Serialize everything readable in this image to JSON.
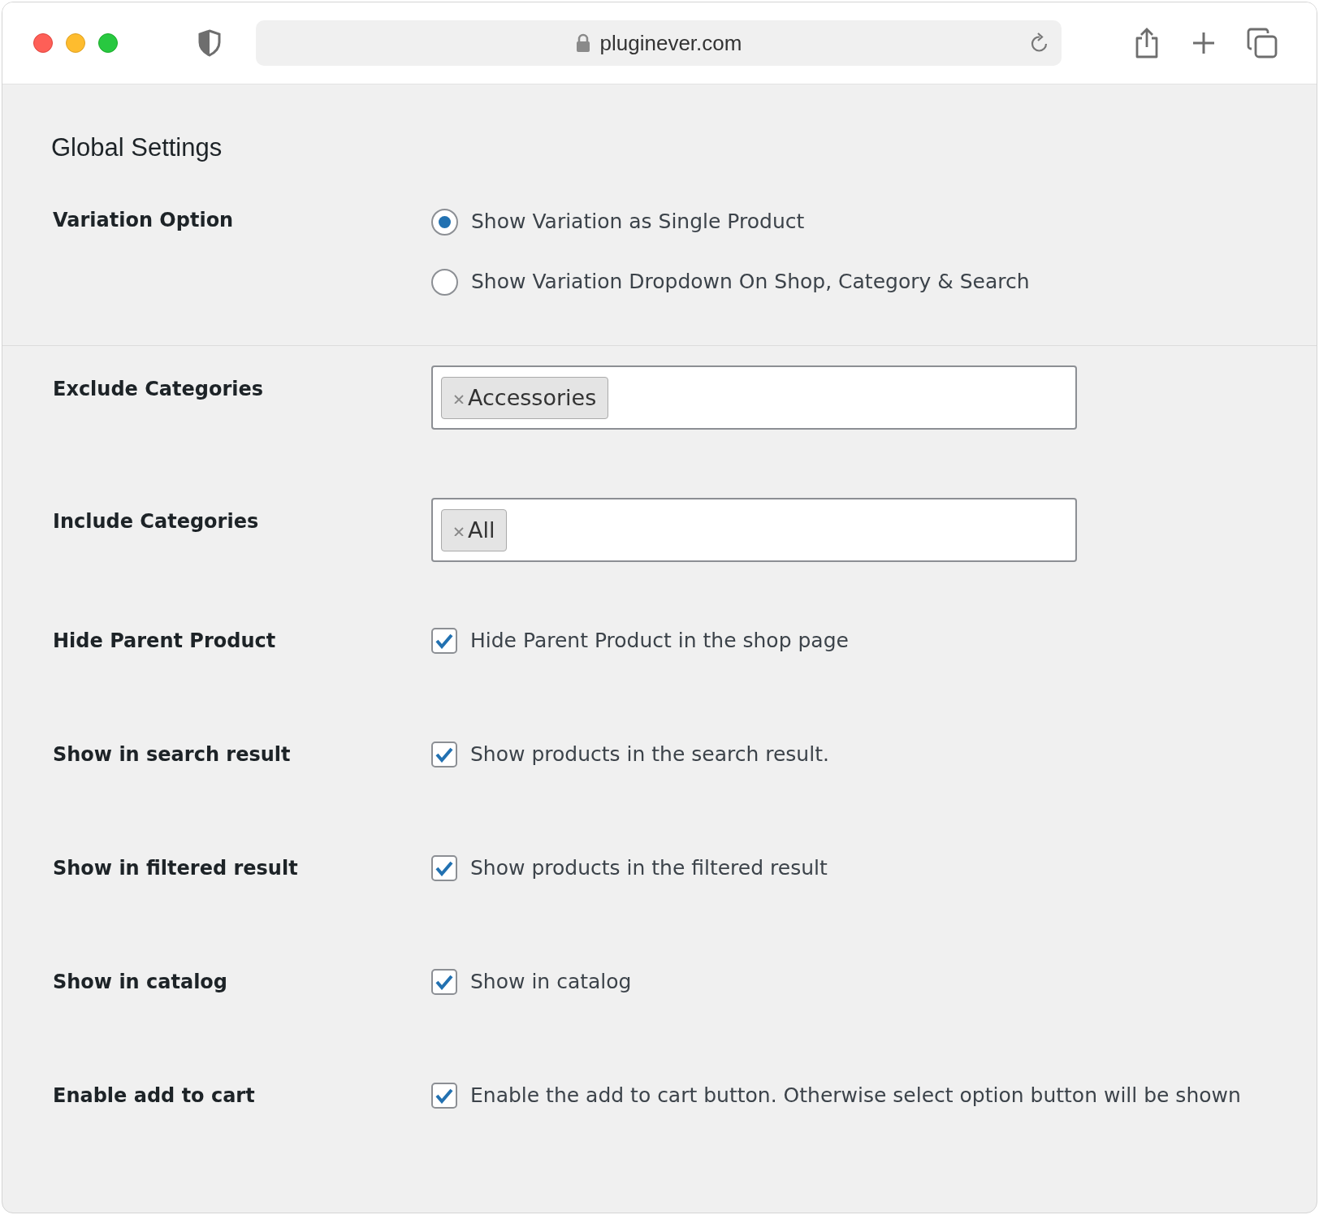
{
  "browser": {
    "url": "pluginever.com"
  },
  "heading": "Global Settings",
  "settings": [
    {
      "kind": "radio",
      "label": "Variation Option",
      "options": [
        {
          "label": "Show Variation as Single Product",
          "selected": true
        },
        {
          "label": "Show Variation Dropdown On Shop, Category & Search",
          "selected": false
        }
      ]
    },
    {
      "kind": "tags",
      "label": "Exclude Categories",
      "tags": [
        "Accessories"
      ]
    },
    {
      "kind": "tags",
      "label": "Include Categories",
      "tags": [
        "All"
      ]
    },
    {
      "kind": "checkbox",
      "label": "Hide Parent Product",
      "text": "Hide Parent Product in the shop page",
      "checked": true
    },
    {
      "kind": "checkbox",
      "label": "Show in search result",
      "text": "Show products in the search result.",
      "checked": true
    },
    {
      "kind": "checkbox",
      "label": "Show in filtered result",
      "text": "Show products in the filtered result",
      "checked": true
    },
    {
      "kind": "checkbox",
      "label": "Show in catalog",
      "text": "Show in catalog",
      "checked": true
    },
    {
      "kind": "checkbox",
      "label": "Enable add to cart",
      "text": "Enable the add to cart button. Otherwise select option button will be shown",
      "checked": true
    }
  ]
}
